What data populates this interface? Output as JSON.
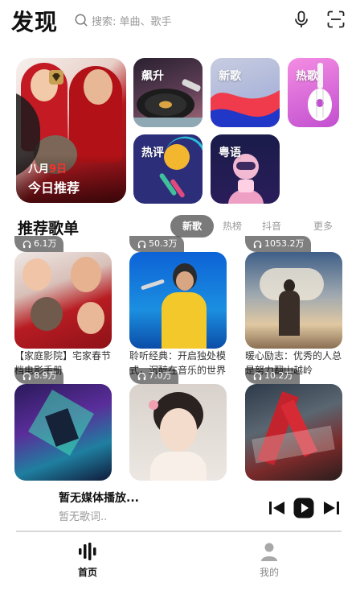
{
  "header": {
    "title": "发现",
    "search_placeholder": "搜索: 单曲、歌手",
    "mic_icon": "microphone-icon",
    "scan_icon": "scan-icon"
  },
  "featured": {
    "date_month": "八月",
    "date_day": "9日",
    "title": "今日推荐"
  },
  "charts": [
    {
      "label": "飙升",
      "icon": "turntable"
    },
    {
      "label": "新歌",
      "icon": "wave"
    },
    {
      "label": "热歌",
      "icon": "ukulele"
    },
    {
      "label": "热评",
      "icon": "bubble"
    },
    {
      "label": "粤语",
      "icon": "astronaut"
    }
  ],
  "section": {
    "title": "推荐歌单",
    "tabs": [
      "新歌",
      "热榜",
      "抖音",
      "更多"
    ],
    "active_tab": "新歌"
  },
  "playlists": [
    {
      "count": "6.1万",
      "name": "【家庭影院】宅家春节档电影手册"
    },
    {
      "count": "50.3万",
      "name": "聆听经典：开启独处模式，沉醉在音乐的世界"
    },
    {
      "count": "1053.2万",
      "name": "暖心励志：优秀的人总是努力翻山越岭"
    },
    {
      "count": "8.9万",
      "name": ""
    },
    {
      "count": "7.0万",
      "name": ""
    },
    {
      "count": "10.2万",
      "name": ""
    }
  ],
  "player": {
    "title": "暂无媒体播放...",
    "subtitle": "暂无歌词.."
  },
  "nav": [
    {
      "label": "首页",
      "active": true
    },
    {
      "label": "我的",
      "active": false
    }
  ],
  "colors": {
    "text": "#111111",
    "muted": "#9a9a9a",
    "tab_active": "#7a7a7a",
    "nav_inactive": "#8a8a8a"
  }
}
